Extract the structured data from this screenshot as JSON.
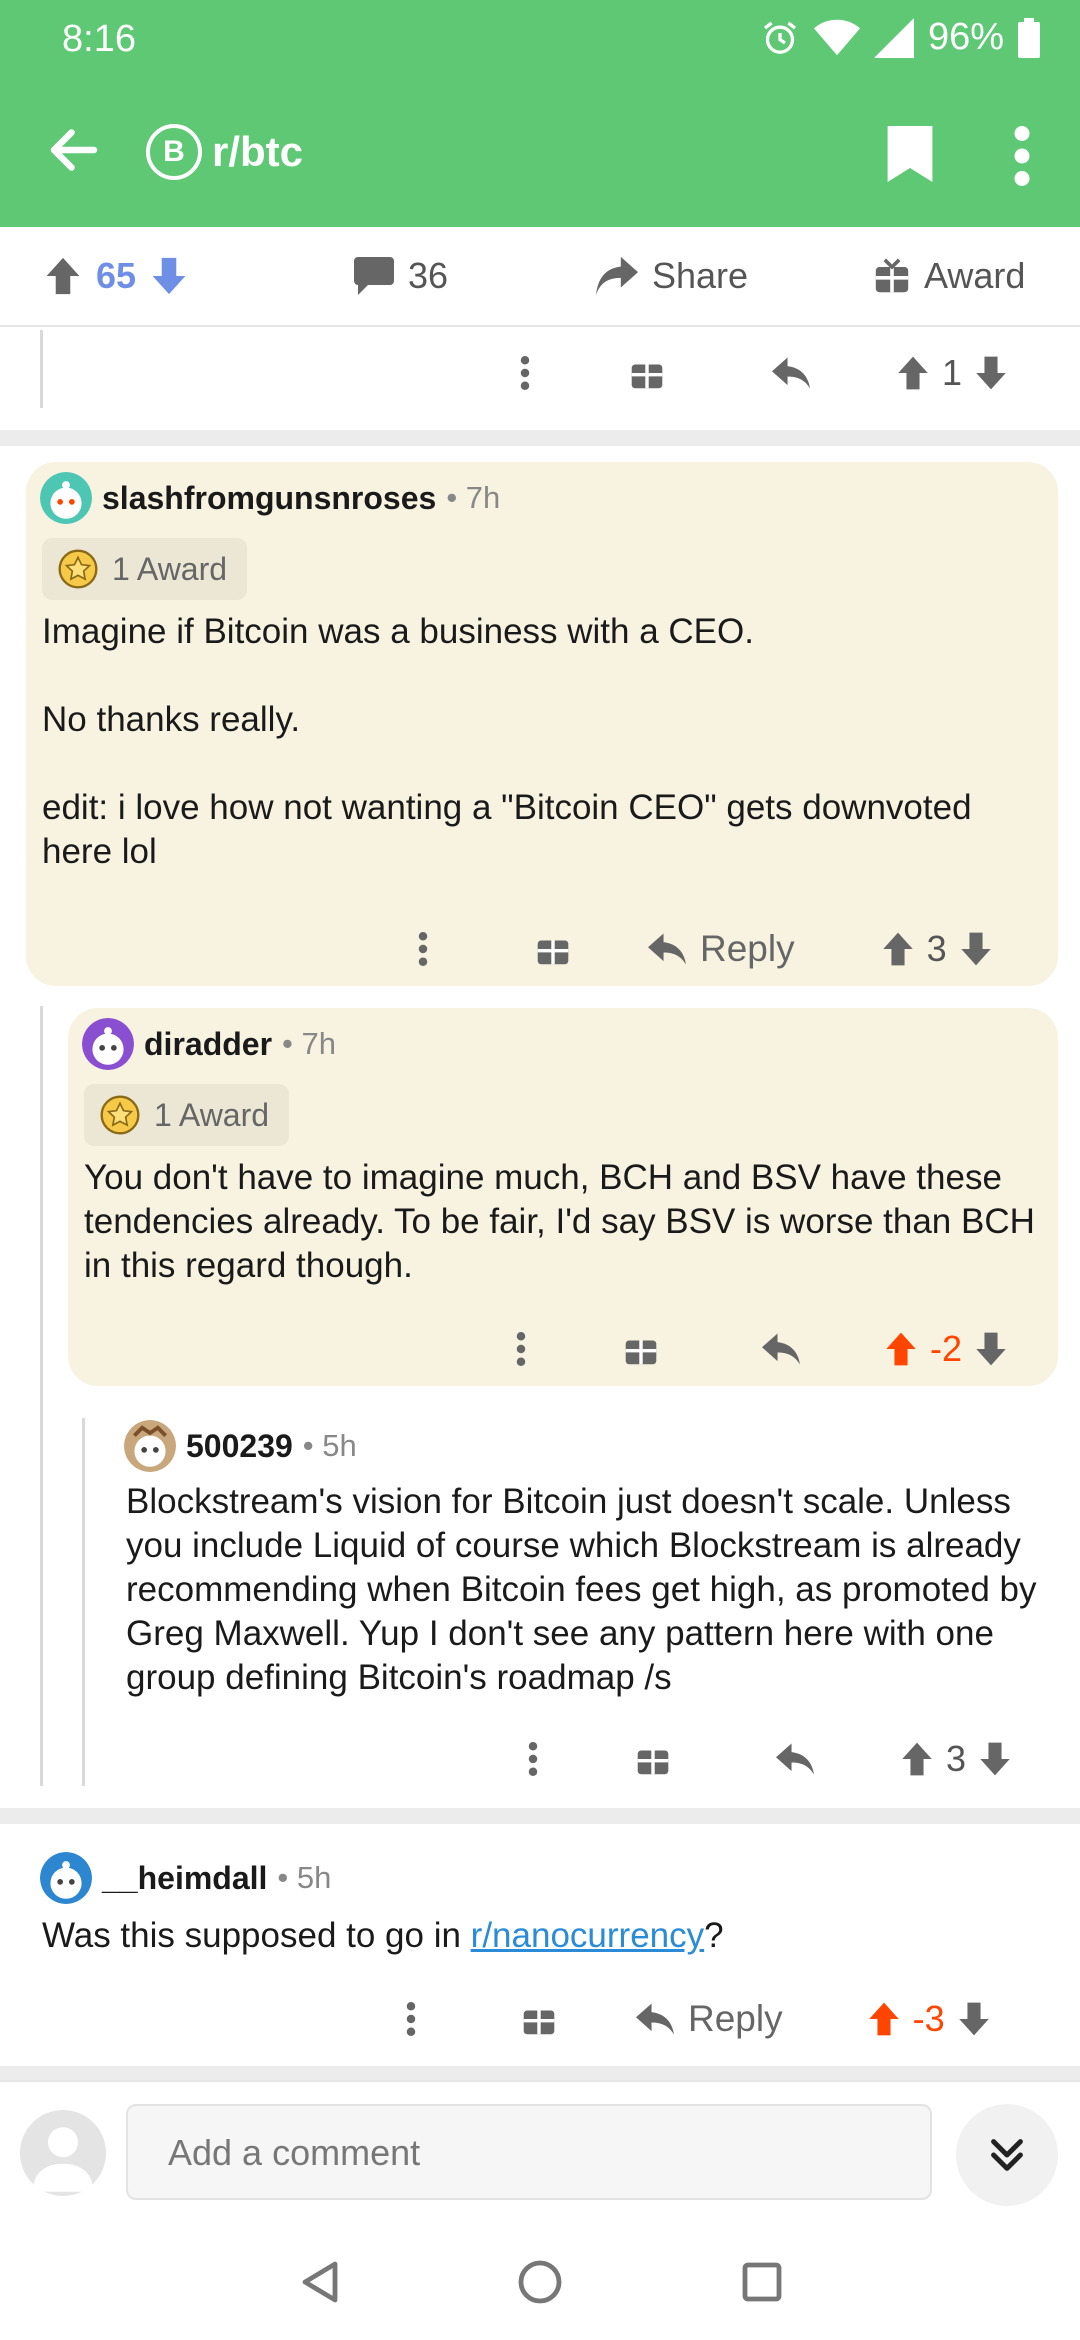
{
  "status": {
    "time": "8:16",
    "battery": "96%"
  },
  "appbar": {
    "subreddit": "r/btc",
    "subreddit_icon": "B"
  },
  "post_bar": {
    "score": "65",
    "comments": "36",
    "share": "Share",
    "award": "Award"
  },
  "top_row": {
    "score": "1"
  },
  "comments": [
    {
      "author": "slashfromgunsnroses",
      "age": "7h",
      "award": "1 Award",
      "body": "Imagine if Bitcoin was a business with a CEO.\n\nNo thanks really.\n\nedit: i love how not wanting a \"Bitcoin CEO\" gets downvoted here lol",
      "reply": "Reply",
      "score": "3"
    },
    {
      "author": "diradder",
      "age": "7h",
      "award": "1 Award",
      "body": "You don't have to imagine much, BCH and BSV have these tendencies already. To be fair, I'd say BSV is worse than BCH in this regard though.",
      "score": "-2"
    },
    {
      "author": "500239",
      "age": "5h",
      "body": "Blockstream's vision for Bitcoin just doesn't scale. Unless you include Liquid of course which Blockstream is already recommending when Bitcoin fees get high, as promoted by Greg Maxwell. Yup I don't see any pattern here with one group defining Bitcoin's roadmap /s",
      "score": "3"
    },
    {
      "author": "__heimdall",
      "age": "5h",
      "body_prefix": "Was this supposed to go in ",
      "body_link": "r/nanocurrency",
      "body_suffix": "?",
      "reply": "Reply",
      "score": "-3"
    }
  ],
  "composer": {
    "placeholder": "Add a comment"
  },
  "colors": {
    "header": "#5ec874",
    "highlight": "#f8f3e0",
    "upvote_active": "#ff4500",
    "score_blue": "#6f8fe6",
    "link": "#2a8bd8"
  }
}
